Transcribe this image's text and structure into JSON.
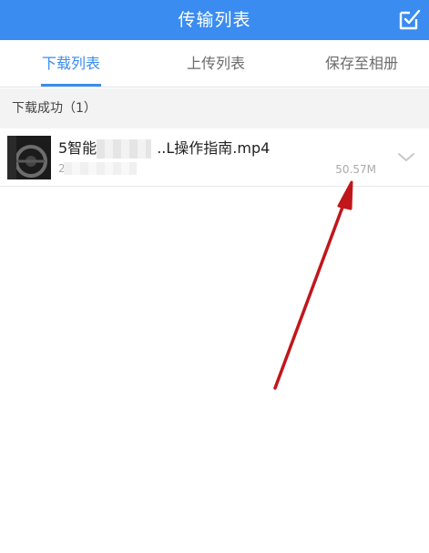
{
  "header": {
    "title": "传输列表",
    "edit_icon": "edit-checkbox-icon"
  },
  "tabs": [
    {
      "label": "下载列表",
      "active": true
    },
    {
      "label": "上传列表",
      "active": false
    },
    {
      "label": "保存至相册",
      "active": false
    }
  ],
  "section": {
    "label": "下载成功（1）"
  },
  "files": [
    {
      "name_prefix": "5智能",
      "name_suffix": "..L操作指南.mp4",
      "date_prefix": "2",
      "size": "50.57M",
      "expand_icon": "chevron-down-icon"
    }
  ],
  "colors": {
    "accent": "#3a8cf0",
    "annotation_arrow": "#c0171b"
  }
}
